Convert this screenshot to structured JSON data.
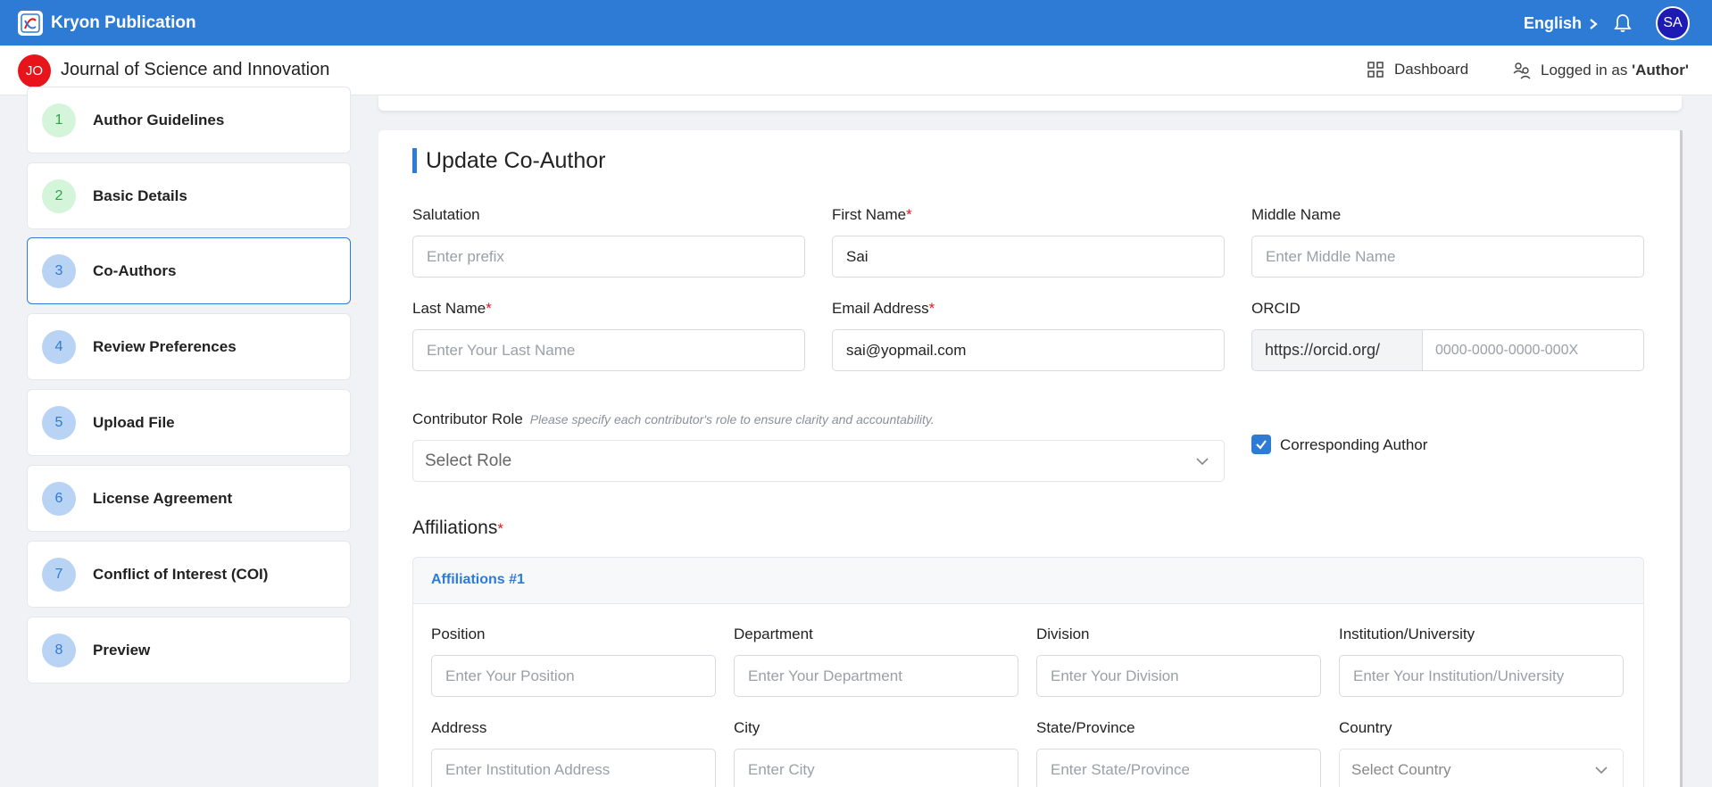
{
  "topbar": {
    "brand": "Kryon Publication",
    "language": "English",
    "user_initials": "SA"
  },
  "subheader": {
    "journal_initials": "JO",
    "journal_title": "Journal of Science and Innovation",
    "dashboard_label": "Dashboard",
    "logged_prefix": "Logged in as ",
    "logged_role": "'Author'"
  },
  "steps": [
    {
      "num": "1",
      "label": "Author Guidelines"
    },
    {
      "num": "2",
      "label": "Basic Details"
    },
    {
      "num": "3",
      "label": "Co-Authors"
    },
    {
      "num": "4",
      "label": "Review Preferences"
    },
    {
      "num": "5",
      "label": "Upload File"
    },
    {
      "num": "6",
      "label": "License Agreement"
    },
    {
      "num": "7",
      "label": "Conflict of Interest (COI)"
    },
    {
      "num": "8",
      "label": "Preview"
    }
  ],
  "form": {
    "title": "Update Co-Author",
    "salutation": {
      "label": "Salutation",
      "placeholder": "Enter prefix"
    },
    "first_name": {
      "label": "First Name",
      "value": "Sai"
    },
    "middle_name": {
      "label": "Middle Name",
      "placeholder": "Enter Middle Name"
    },
    "last_name": {
      "label": "Last Name",
      "placeholder": "Enter Your Last Name"
    },
    "email": {
      "label": "Email Address",
      "value": "sai@yopmail.com"
    },
    "orcid": {
      "label": "ORCID",
      "prefix": "https://orcid.org/",
      "placeholder": "0000-0000-0000-000X"
    },
    "contributor_role": {
      "label": "Contributor Role",
      "hint": "Please specify each contributor's role to ensure clarity and accountability.",
      "placeholder": "Select Role"
    },
    "corresponding_author": {
      "label": "Corresponding Author",
      "checked": true
    },
    "required_mark": "*"
  },
  "affiliations": {
    "title": "Affiliations",
    "block_title": "Affiliations #1",
    "position": {
      "label": "Position",
      "placeholder": "Enter Your Position"
    },
    "department": {
      "label": "Department",
      "placeholder": "Enter Your Department"
    },
    "division": {
      "label": "Division",
      "placeholder": "Enter Your Division"
    },
    "institution": {
      "label": "Institution/University",
      "placeholder": "Enter Your Institution/University"
    },
    "address": {
      "label": "Address",
      "placeholder": "Enter Institution Address"
    },
    "city": {
      "label": "City",
      "placeholder": "Enter City"
    },
    "state": {
      "label": "State/Province",
      "placeholder": "Enter State/Province"
    },
    "country": {
      "label": "Country",
      "placeholder": "Select Country"
    }
  },
  "colors": {
    "primary": "#2e7bd6",
    "danger": "#e8141b",
    "success_bg": "#d4f5d9",
    "pending_bg": "#b8d3f3"
  }
}
